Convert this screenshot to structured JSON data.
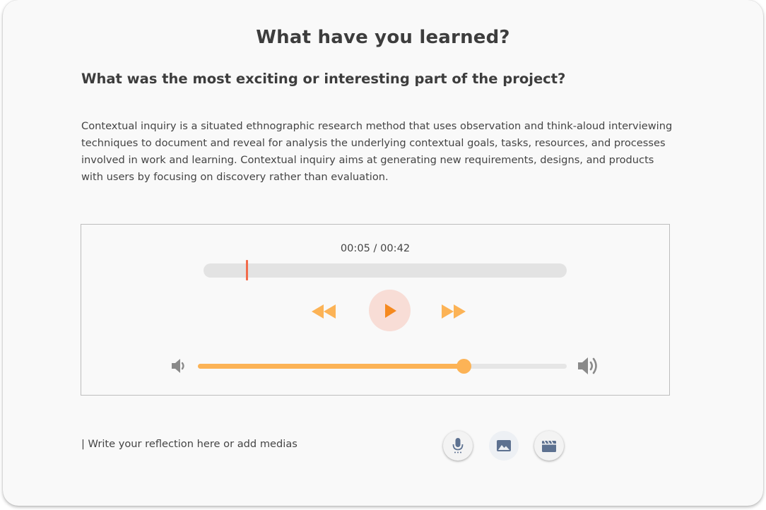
{
  "title": "What have you learned?",
  "question": "What was the most exciting or interesting part of the project?",
  "description": "Contextual inquiry is a situated ethnographic research method that uses observation and think-aloud interviewing techniques to document and reveal for analysis the underlying contextual goals, tasks, resources, and processes involved in work and learning. Contextual inquiry aims at generating new requirements, designs, and products with users by focusing on discovery rather than evaluation.",
  "player": {
    "time_display": "00:05 / 00:42",
    "current_seconds": 5,
    "total_seconds": 42,
    "volume_fraction": 0.72,
    "icons": {
      "rewind": "rewind-icon",
      "play": "play-icon",
      "forward": "fast-forward-icon",
      "volume_low": "volume-low-icon",
      "volume_high": "volume-high-icon"
    },
    "colors": {
      "accent": "#fcb356",
      "play_icon": "#f5891f",
      "play_bg": "#f8ddd6",
      "playhead": "#f26b4b"
    }
  },
  "reflection": {
    "placeholder": "| Write your reflection here or add medias"
  },
  "media_buttons": [
    {
      "icon": "microphone-icon"
    },
    {
      "icon": "image-icon"
    },
    {
      "icon": "movie-clapper-icon"
    }
  ]
}
